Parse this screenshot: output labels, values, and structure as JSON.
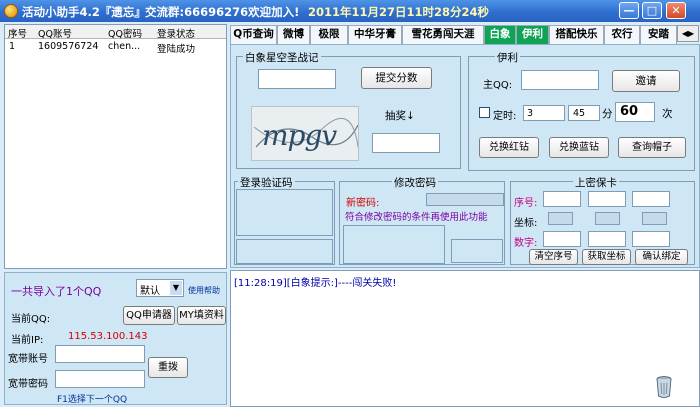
{
  "window": {
    "app_title": "活动小助手4.2『遗忘』",
    "qq_group": "交流群:66696276欢迎加入!",
    "datetime": "2011年11月27日11时28分24秒",
    "minimize": "—",
    "maximize": "□",
    "close": "✕"
  },
  "accounts": {
    "columns": [
      "序号",
      "QQ账号",
      "QQ密码",
      "登录状态"
    ],
    "rows": [
      [
        "1",
        "1609576724",
        "chen...",
        "登陆成功"
      ]
    ]
  },
  "left_panel": {
    "import_count": "一共导入了1个QQ",
    "mode_selected": "默认",
    "help_link": "使用帮助",
    "current_qq_label": "当前QQ:",
    "qq_applicant_button": "QQ申请器",
    "fill_profile_button": "MY填资料",
    "current_ip_label": "当前IP:",
    "current_ip_value": "115.53.100.143",
    "broadband_account_label": "宽带账号",
    "broadband_password_label": "宽带密码",
    "redial_button": "重拨",
    "next_qq_hint": "F1选择下一个QQ"
  },
  "tabs": [
    {
      "label": "Q币查询"
    },
    {
      "label": "微博"
    },
    {
      "label": "极限"
    },
    {
      "label": "中华牙膏"
    },
    {
      "label": "雪花勇闯天涯"
    },
    {
      "label": "白象"
    },
    {
      "label": "伊利"
    },
    {
      "label": "搭配快乐"
    },
    {
      "label": "农行"
    },
    {
      "label": "安踏"
    }
  ],
  "baixiang": {
    "group_title": "白象星空圣战记",
    "submit_button": "提交分数",
    "lottery_label": "抽奖↓",
    "captcha_text": "mpgv"
  },
  "yili": {
    "group_title": "伊利",
    "qq_label": "主QQ:",
    "invite_button": "邀请",
    "timer_label": "定时:",
    "timer_hour": "3",
    "timer_min": "45",
    "min_unit": "分",
    "count": "60",
    "count_unit": "次",
    "red_button": "兑换红钻",
    "blue_button": "兑换蓝钻",
    "hat_button": "查询帽子"
  },
  "login_captcha": {
    "group_title": "登录验证码"
  },
  "change_password": {
    "group_title": "修改密码",
    "new_password_label": "新密码:",
    "condition_text": "符合修改密码的条件再使用此功能"
  },
  "secret_card": {
    "group_title": "上密保卡",
    "row_label_seq": "序号:",
    "row_label_coord": "坐标:",
    "row_label_digit": "数字:",
    "clear_button": "清空序号",
    "get_coord_button": "获取坐标",
    "confirm_button": "确认绑定"
  },
  "log": {
    "line": "[11:28:19][白象提示:]----闯关失败!"
  }
}
